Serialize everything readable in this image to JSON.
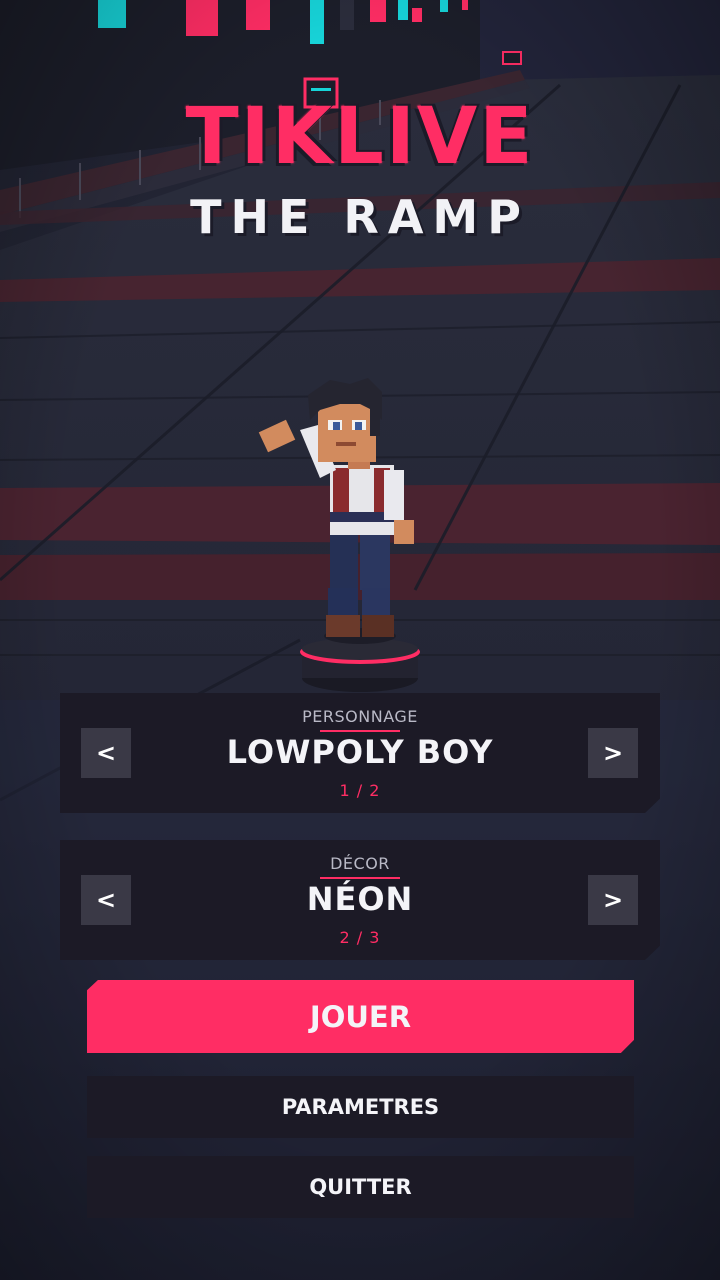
{
  "title": {
    "main": "TIKLIVE",
    "sub": "THE RAMP"
  },
  "character_selector": {
    "label": "PERSONNAGE",
    "value": "LOWPOLY BOY",
    "count": "1 / 2",
    "prev_label": "<",
    "next_label": ">"
  },
  "decor_selector": {
    "label": "DÉCOR",
    "value": "NÉON",
    "count": "2 / 3",
    "prev_label": "<",
    "next_label": ">"
  },
  "menu": {
    "play_label": "JOUER",
    "settings_label": "PARAMETRES",
    "quit_label": "QUITTER"
  },
  "colors": {
    "accent": "#ff2d64",
    "panel": "#1c1a26",
    "arrow_button": "#3a3946",
    "floor": "#272a3a",
    "floor_red_stripe": "#4a2330",
    "neon_cyan": "#17d4d9"
  }
}
